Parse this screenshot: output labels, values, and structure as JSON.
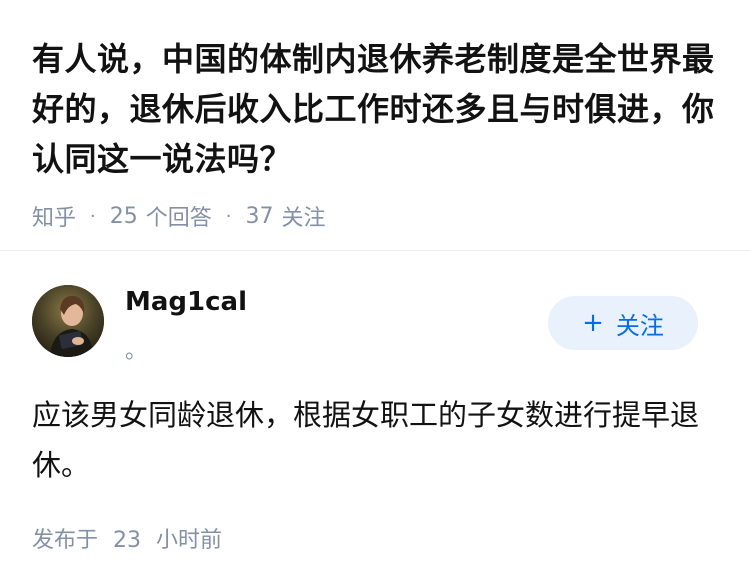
{
  "question": {
    "title": "有人说，中国的体制内退休养老制度是全世界最好的，退休后收入比工作时还多且与时俱进，你认同这一说法吗？",
    "source": "知乎",
    "answer_count": "25",
    "answer_unit": "个回答",
    "follower_count": "37",
    "follower_unit": "关注",
    "separator": "·"
  },
  "author": {
    "name": "Mag1cal",
    "headline": "。",
    "follow_label": "关注",
    "follow_plus": "+"
  },
  "answer": {
    "text": "应该男女同龄退休，根据女职工的子女数进行提早退休。",
    "time_prefix": "发布于",
    "time_value": "23",
    "time_unit": "小时前"
  },
  "colors": {
    "title_text": "#121212",
    "meta_text": "#8590a6",
    "accent_blue": "#056de8",
    "follow_button_bg": "#e8f1fc",
    "divider": "#ebebeb"
  }
}
